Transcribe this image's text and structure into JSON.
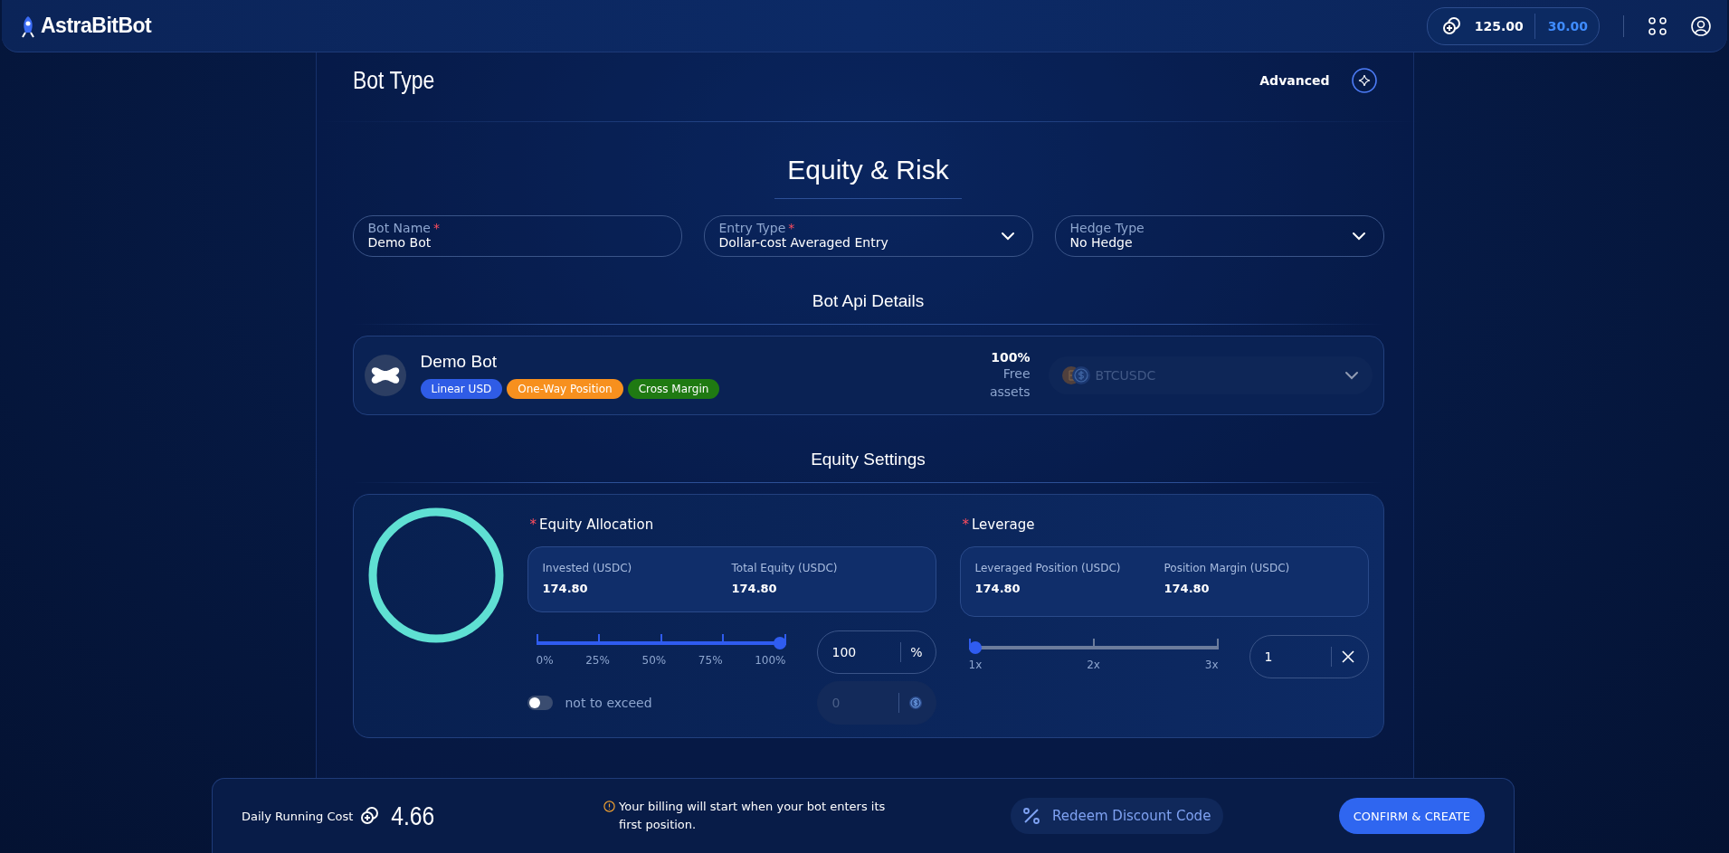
{
  "header": {
    "logo": "AstraBitBot",
    "balance_primary": "125.00",
    "balance_secondary": "30.00"
  },
  "bot_type": {
    "title": "Bot Type",
    "mode_label": "Advanced"
  },
  "section_title": "Equity & Risk",
  "fields": [
    {
      "kind": "text",
      "label": "Bot Name",
      "required_mark": "*",
      "value": "Demo Bot"
    },
    {
      "kind": "select",
      "label": "Entry Type",
      "required_mark": "*",
      "value": "Dollar-cost Averaged Entry"
    },
    {
      "kind": "select",
      "label": "Hedge Type",
      "value": "No Hedge"
    }
  ],
  "api_details": {
    "title": "Bot Api Details",
    "bot_name": "Demo Bot",
    "tags": [
      {
        "label": "Linear USD",
        "color": "#2f5ce6"
      },
      {
        "label": "One-Way Position",
        "color": "#f7901e"
      },
      {
        "label": "Cross Margin",
        "color": "#1f7a12"
      }
    ],
    "free_percent": "100%",
    "free_label": "Free assets",
    "pair_select": {
      "value": "BTCUSDC",
      "disabled": true
    }
  },
  "equity_settings": {
    "title": "Equity Settings",
    "allocation": {
      "label": "Equity Allocation",
      "required_mark": "*",
      "stats": [
        {
          "label": "Invested (USDC)",
          "value": "174.80"
        },
        {
          "label": "Total Equity (USDC)",
          "value": "174.80"
        }
      ],
      "slider": {
        "level": 1,
        "ticks": [
          "0%",
          "25%",
          "50%",
          "75%",
          "100%"
        ]
      },
      "input": {
        "value": "100",
        "unit": "%"
      },
      "cap_toggle": {
        "label": "not to exceed",
        "on": false
      },
      "cap_input": {
        "placeholder": "0",
        "disabled": true
      }
    },
    "leverage": {
      "label": "Leverage",
      "required_mark": "*",
      "stats": [
        {
          "label": "Leveraged Position (USDC)",
          "value": "174.80"
        },
        {
          "label": "Position Margin (USDC)",
          "value": "174.80"
        }
      ],
      "slider": {
        "level": 0,
        "ticks": [
          "1x",
          "2x",
          "3x"
        ]
      },
      "input": {
        "value": "1"
      }
    }
  },
  "footer": {
    "cost_label": "Daily Running Cost",
    "cost_value": "4.66",
    "notice": "Your billing will start when your bot enters its first position.",
    "redeem_label": "Redeem Discount Code",
    "confirm_label": "CONFIRM & CREATE"
  }
}
